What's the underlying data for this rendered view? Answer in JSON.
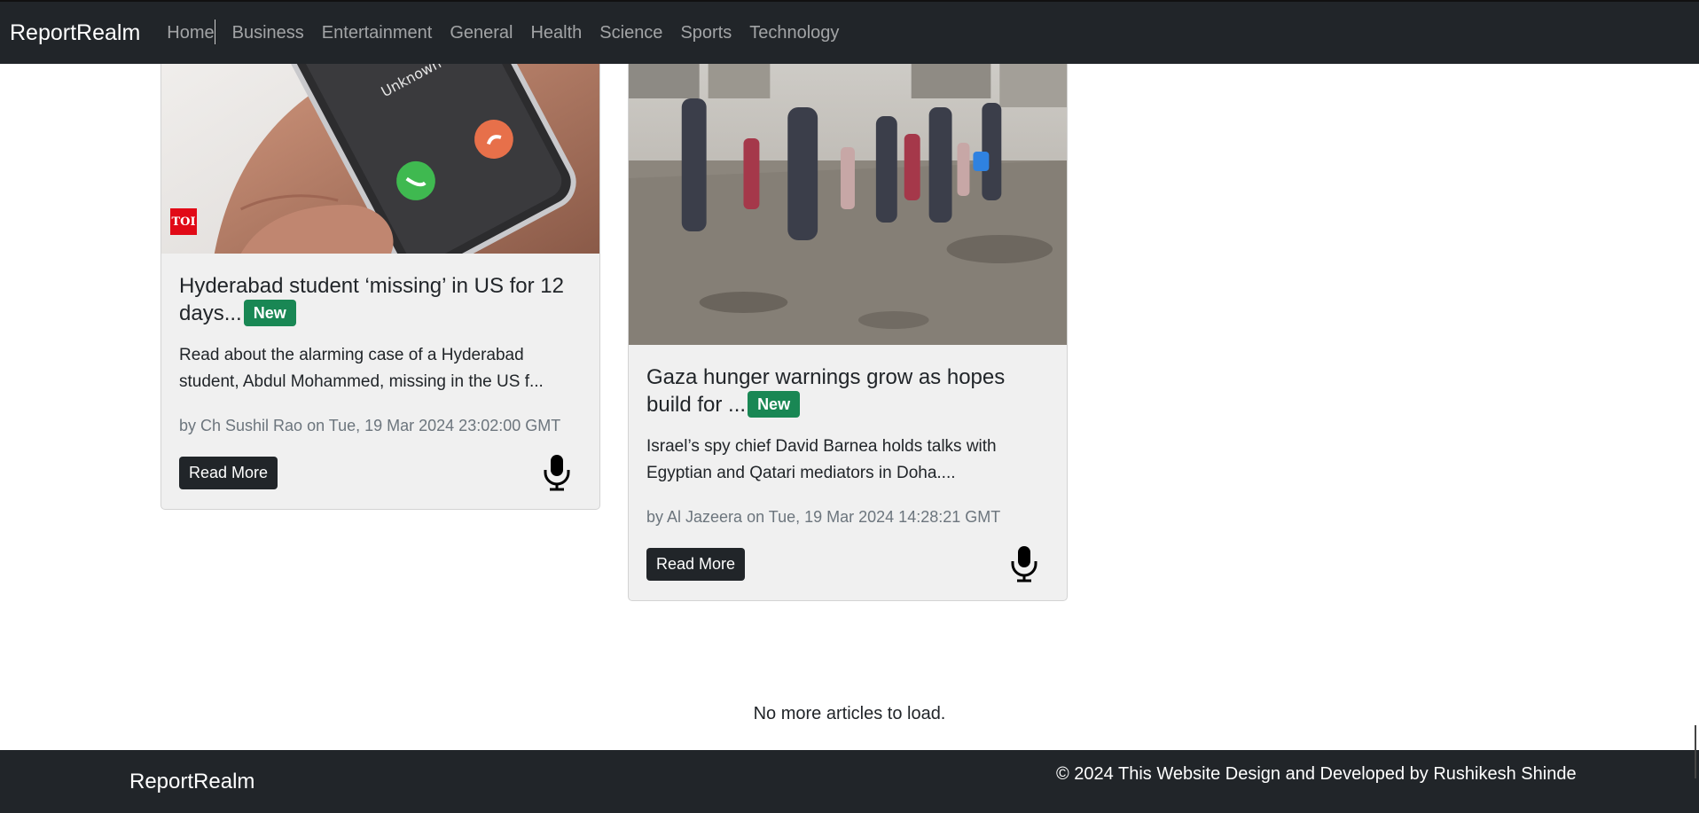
{
  "nav": {
    "brand": "ReportRealm",
    "links": [
      "Home",
      "Business",
      "Entertainment",
      "General",
      "Health",
      "Science",
      "Sports",
      "Technology"
    ]
  },
  "articles": [
    {
      "title": "Hyderabad student ‘missing’ in US for 12 days...",
      "badge": "New",
      "description": "Read about the alarming case of a Hyderabad student, Abdul Mohammed, missing in the US f...",
      "meta": "by Ch Sushil Rao on Tue, 19 Mar 2024 23:02:00 GMT",
      "read_more": "Read More",
      "source_logo": "TOI",
      "image_subject": "phone-call-icon"
    },
    {
      "title": "Gaza hunger warnings grow as hopes build for ...",
      "badge": "New",
      "description": "Israel’s spy chief David Barnea holds talks with Egyptian and Qatari mediators in Doha....",
      "meta": "by Al Jazeera on Tue, 19 Mar 2024 14:28:21 GMT",
      "read_more": "Read More",
      "image_subject": "rubble-street-photo"
    }
  ],
  "status": {
    "no_more": "No more articles to load."
  },
  "footer": {
    "brand": "ReportRealm",
    "copyright": "© 2024 This Website Design and Developed by Rushikesh Shinde"
  },
  "colors": {
    "navbar": "#212529",
    "badge": "#198754",
    "button": "#212529",
    "card": "#f0f0f0"
  },
  "icons": {
    "mic": "microphone-icon"
  }
}
